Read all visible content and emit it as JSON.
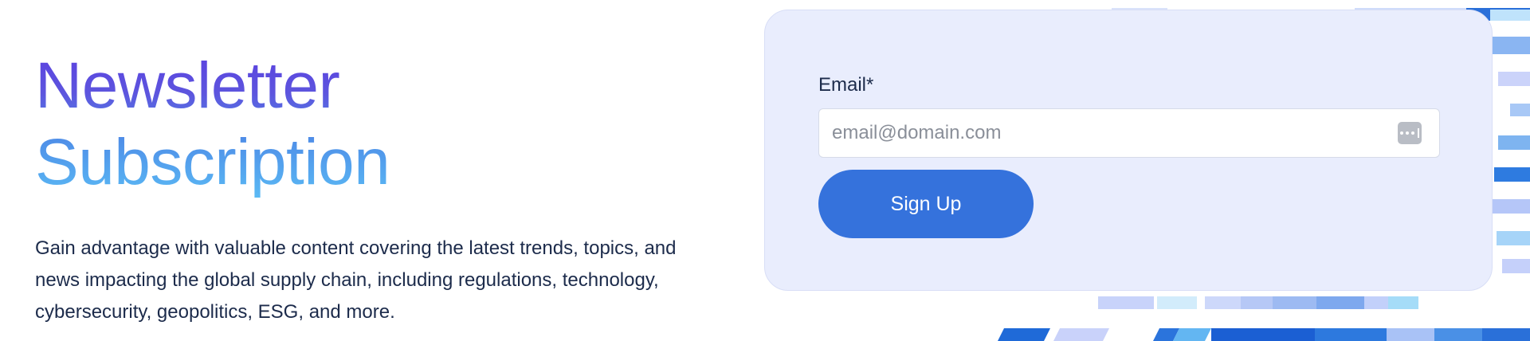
{
  "hero": {
    "title_line1": "Newsletter",
    "title_line2": "Subscription",
    "description": "Gain advantage with valuable content covering the latest trends, topics, and news impacting the global supply chain, including regulations, technology, cybersecurity, geopolitics, ESG, and more."
  },
  "form": {
    "email_label": "Email*",
    "email_value": "",
    "email_placeholder": "email@domain.com",
    "password_manager_icon": "password-manager-icon",
    "submit_label": "Sign Up"
  },
  "colors": {
    "title_gradient": [
      "#5b3fe0",
      "#5bbcf5"
    ],
    "card_bg": "#e9edfd",
    "button_bg": "#3572dc",
    "text": "#1c2b4b"
  }
}
